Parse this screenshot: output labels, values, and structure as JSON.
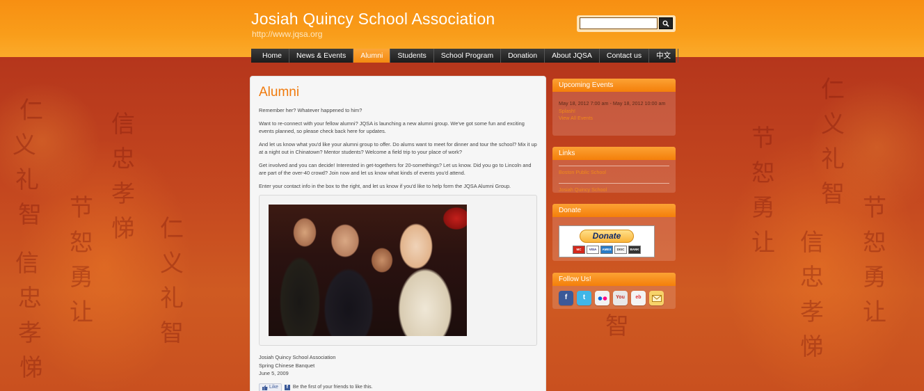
{
  "header": {
    "title": "Josiah Quincy School Association",
    "url": "http://www.jqsa.org",
    "search": {
      "value": "",
      "placeholder": ""
    }
  },
  "nav": {
    "items": [
      {
        "label": "Home",
        "active": false
      },
      {
        "label": "News & Events",
        "active": false
      },
      {
        "label": "Alumni",
        "active": true
      },
      {
        "label": "Students",
        "active": false
      },
      {
        "label": "School Program",
        "active": false
      },
      {
        "label": "Donation",
        "active": false
      },
      {
        "label": "About JQSA",
        "active": false
      },
      {
        "label": "Contact us",
        "active": false
      },
      {
        "label": "中文",
        "active": false
      }
    ]
  },
  "main": {
    "title": "Alumni",
    "paragraphs": [
      "Remember her? Whatever happened to him?",
      "Want to re-connect with your fellow alumni? JQSA is launching a new alumni group. We've got some fun and exciting events planned, so please check back here for updates.",
      "And let us know what you'd like your alumni group to offer. Do alums want to meet for dinner and tour the school? Mix it up at a night out in Chinatown? Mentor students? Welcome a field trip to your place of work?",
      "Get involved and you can decide! Interested in get-togethers for 20-somethings? Let us know. Did you go to Lincoln and are part of the over-40 crowd? Join now and let us know what kinds of events you'd attend.",
      "Enter your contact info in the box to the right, and let us know if you'd like to help form the JQSA Alumni Group."
    ],
    "caption": {
      "line1": "Josiah Quincy School Association",
      "line2": "Spring Chinese Banquet",
      "line3": "June 5, 2009"
    },
    "like": {
      "button": "Like",
      "text": "Be the first of your friends to like this."
    }
  },
  "sidebar": {
    "events": {
      "heading": "Upcoming Events",
      "date": "May 18, 2012 7:00 am - May 18, 2012 10:00 am",
      "event": "Splash!",
      "view_all": "View All Events"
    },
    "links": {
      "heading": "Links",
      "items": [
        "Boston Public School",
        "Josiah Quincy School"
      ]
    },
    "donate": {
      "heading": "Donate",
      "button": "Donate",
      "cards": [
        "MC",
        "VISA",
        "AMEX",
        "DISC",
        "BANK"
      ]
    },
    "follow": {
      "heading": "Follow Us!",
      "icons": [
        "facebook-icon",
        "twitter-icon",
        "flickr-icon",
        "youtube-icon",
        "ebay-icon",
        "email-icon"
      ]
    }
  },
  "colors": {
    "header_orange": "#f99d1a",
    "accent_orange": "#f07a0c",
    "background_red": "#b8361a",
    "nav_dark": "#2a2a2a"
  }
}
